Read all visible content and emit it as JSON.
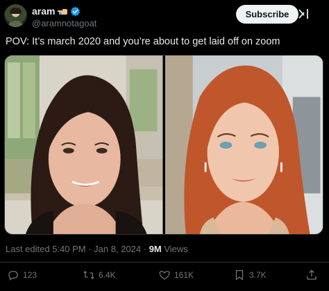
{
  "author": {
    "display_name": "aram",
    "handle": "@aramnotagoat",
    "emoji_icon": "hand-pointing-emoji",
    "verified_icon": "verified-badge-icon"
  },
  "subscribe_label": "Subscribe",
  "grok_icon": "grok-icon",
  "post": {
    "text": "POV: It’s march 2020 and you’re about to get laid off on zoom"
  },
  "media": {
    "images": [
      "image-left",
      "image-right"
    ]
  },
  "meta": {
    "edited": "Last edited 5:40 PM · Jan 8, 2024 · ",
    "views_count": "9M",
    "views_label": " Views"
  },
  "actions": {
    "replies": "123",
    "reposts": "6.4K",
    "likes": "161K",
    "bookmarks": "3.7K"
  },
  "colors": {
    "background": "#000000",
    "text": "#e7e9ea",
    "muted": "#71767b",
    "verified": "#1d9bf0",
    "subscribe_bg": "#eff3f4"
  }
}
